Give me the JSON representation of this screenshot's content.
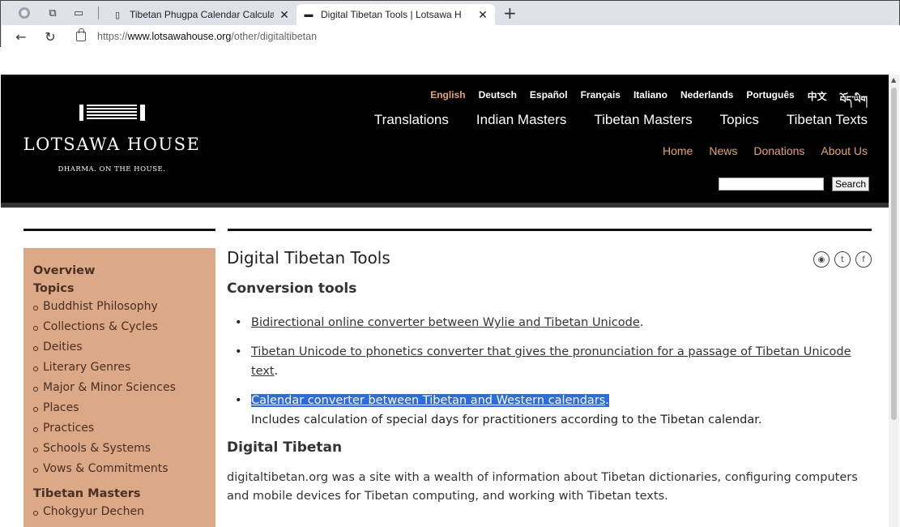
{
  "browser": {
    "tabs": [
      {
        "title": "Tibetan Phugpa Calendar Calcula",
        "active": false
      },
      {
        "title": "Digital Tibetan Tools | Lotsawa H",
        "active": true
      }
    ],
    "url": {
      "scheme": "https://",
      "host": "www.lotsawahouse.org",
      "path": "/other/digitaltibetan"
    }
  },
  "site": {
    "logo_name": "LOTSAWA HOUSE",
    "logo_tag": "DHARMA. ON THE HOUSE.",
    "languages": [
      "English",
      "Deutsch",
      "Español",
      "Français",
      "Italiano",
      "Nederlands",
      "Português",
      "中文",
      "བོད་ཡིག"
    ],
    "main_nav": [
      "Translations",
      "Indian Masters",
      "Tibetan Masters",
      "Topics",
      "Tibetan Texts"
    ],
    "sub_nav": [
      "Home",
      "News",
      "Donations",
      "About Us"
    ],
    "search_button": "Search"
  },
  "sidebar": {
    "overview": "Overview",
    "topics_head": "Topics",
    "topics": [
      "Buddhist Philosophy",
      "Collections & Cycles",
      "Deities",
      "Literary Genres",
      "Major & Minor Sciences",
      "Places",
      "Practices",
      "Schools & Systems",
      "Vows & Commitments"
    ],
    "masters_head": "Tibetan Masters",
    "masters": [
      "Chokgyur Dechen"
    ]
  },
  "content": {
    "title": "Digital Tibetan Tools",
    "conversion_heading": "Conversion tools",
    "tools": [
      {
        "link": "Bidirectional online converter between Wylie and Tibetan Unicode",
        "suffix": "."
      },
      {
        "link": "Tibetan Unicode to phonetics converter that gives the pronunciation for a passage of Tibetan Unicode text",
        "suffix": "."
      },
      {
        "link": "Calendar converter between Tibetan and Western calendars",
        "suffix": ".",
        "note": "Includes calculation of special days for practitioners according to the Tibetan calendar."
      }
    ],
    "digital_heading": "Digital Tibetan",
    "digital_para": "digitaltibetan.org was a site with a wealth of information about Tibetan dictionaries, configuring computers and mobile devices for Tibetan computing, and working with Tibetan texts."
  },
  "colors": {
    "accent": "#e6a468",
    "sidebar_bg": "#dba888",
    "selection": "#2d6cdf"
  }
}
